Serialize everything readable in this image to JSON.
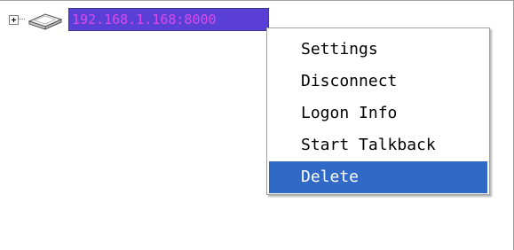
{
  "tree": {
    "node": {
      "label": "192.168.1.168:8000",
      "icon": "network-device-icon",
      "expander_icon": "plus-box-icon",
      "selected": true,
      "label_background": "#5a3fd6",
      "label_text_color": "#d84be8"
    }
  },
  "context_menu": {
    "selected_index": 4,
    "highlight_color": "#3169c6",
    "items": [
      {
        "label": "Settings"
      },
      {
        "label": "Disconnect"
      },
      {
        "label": "Logon Info"
      },
      {
        "label": "Start Talkback"
      },
      {
        "label": "Delete"
      }
    ]
  }
}
